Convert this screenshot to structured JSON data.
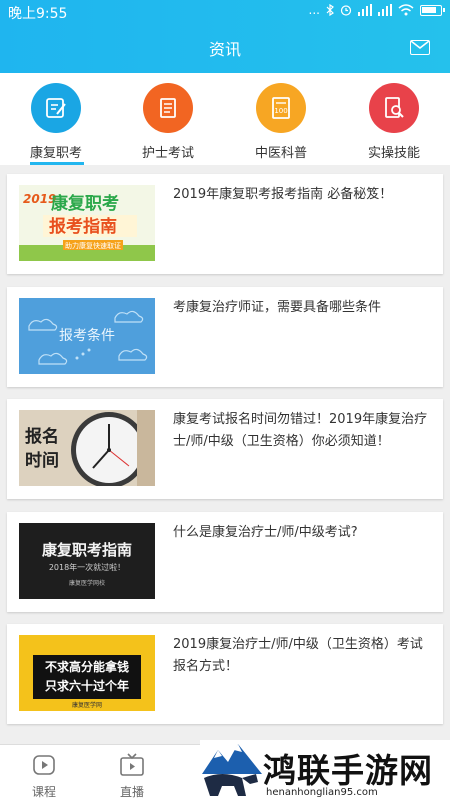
{
  "status": {
    "time": "晚上9:55",
    "signal": "..."
  },
  "header": {
    "title": "资讯",
    "mail_icon": "mail-icon"
  },
  "categories": [
    {
      "label": "康复职考",
      "icon": "edit-icon",
      "color": "#1aa6e4",
      "selected": true
    },
    {
      "label": "护士考试",
      "icon": "document-icon",
      "color": "#f26522"
    },
    {
      "label": "中医科普",
      "icon": "score-sheet-icon",
      "color": "#f7a623"
    },
    {
      "label": "实操技能",
      "icon": "search-document-icon",
      "color": "#e8424a"
    }
  ],
  "news": [
    {
      "title": "2019年康复职考报考指南 必备秘笈！",
      "thumb": {
        "year": "2019",
        "line1": "康复职考",
        "line2": "报考指南",
        "tag": "助力康复快速取证"
      }
    },
    {
      "title": "考康复治疗师证，需要具备哪些条件",
      "thumb": {
        "text": "报考条件"
      }
    },
    {
      "title": "康复考试报名时间勿错过！2019年康复治疗士/师/中级（卫生资格）你必须知道！",
      "thumb": {
        "line1": "报名",
        "line2": "时间"
      }
    },
    {
      "title": "什么是康复治疗士/师/中级考试?",
      "thumb": {
        "main": "康复职考指南",
        "sub": "2018年一次就过啦！",
        "brand": "康复医学网校"
      }
    },
    {
      "title": "2019康复治疗士/师/中级（卫生资格）考试报名方式！",
      "thumb": {
        "line1": "不求高分能拿钱",
        "line2": "只求六十过个年",
        "brand": "康复医学网"
      }
    }
  ],
  "tabs": [
    {
      "label": "课程",
      "icon": "play-icon"
    },
    {
      "label": "直播",
      "icon": "tv-icon"
    }
  ],
  "watermark": {
    "cn": "鸿联手游网",
    "en": "henanhonglian95.com"
  }
}
